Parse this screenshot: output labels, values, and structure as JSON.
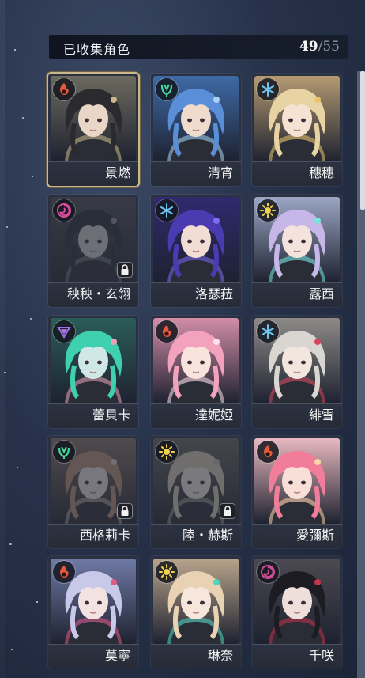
{
  "header": {
    "title": "已收集角色",
    "collected": "49",
    "separator": "/",
    "total": "55"
  },
  "characters": [
    {
      "name": "景燃",
      "element": "fire",
      "locked": false,
      "selected": true,
      "hair": "#2b2a2e",
      "skin": "#e9d6c6",
      "bg": "#6c6a5e",
      "accent": "#c9b98a"
    },
    {
      "name": "清宵",
      "element": "wind",
      "locked": false,
      "selected": false,
      "hair": "#5a8ed6",
      "skin": "#f0dccd",
      "bg": "#3e6aa6",
      "accent": "#a9d3f2"
    },
    {
      "name": "穗穗",
      "element": "ice",
      "locked": false,
      "selected": false,
      "hair": "#e8d3a4",
      "skin": "#f6e2d2",
      "bg": "#b49a72",
      "accent": "#e9c46a"
    },
    {
      "name": "秧秧・玄翎",
      "element": "void",
      "locked": true,
      "selected": false,
      "hair": "#2a2a33",
      "skin": "#cfc3bb",
      "bg": "#4a4a50",
      "accent": "#888888"
    },
    {
      "name": "洛瑟菈",
      "element": "ice",
      "locked": false,
      "selected": false,
      "hair": "#4b3bb0",
      "skin": "#f1ddd4",
      "bg": "#2f2a6e",
      "accent": "#7f6cf0"
    },
    {
      "name": "露西",
      "element": "light",
      "locked": false,
      "selected": false,
      "hair": "#c7b6e8",
      "skin": "#f4e3dc",
      "bg": "#9ba6c4",
      "accent": "#75e6e0"
    },
    {
      "name": "蕾貝卡",
      "element": "aero",
      "locked": false,
      "selected": false,
      "hair": "#3fd0b0",
      "skin": "#cfe7e6",
      "bg": "#2b5c58",
      "accent": "#f0a0b8"
    },
    {
      "name": "達妮婭",
      "element": "fire",
      "locked": false,
      "selected": false,
      "hair": "#f3a2bd",
      "skin": "#f8e4dc",
      "bg": "#d28ea8",
      "accent": "#ffe0ea"
    },
    {
      "name": "緋雪",
      "element": "ice",
      "locked": false,
      "selected": false,
      "hair": "#d9d6d2",
      "skin": "#f3e6de",
      "bg": "#8d8a88",
      "accent": "#d6455a"
    },
    {
      "name": "西格莉卡",
      "element": "wind",
      "locked": true,
      "selected": false,
      "hair": "#e7803a",
      "skin": "#f0d6c4",
      "bg": "#9a6a4a",
      "accent": "#f3c38a"
    },
    {
      "name": "陸・赫斯",
      "element": "light",
      "locked": true,
      "selected": false,
      "hair": "#d9c48a",
      "skin": "#eedcc6",
      "bg": "#6b6450",
      "accent": "#c8b27a"
    },
    {
      "name": "愛彌斯",
      "element": "fire",
      "locked": false,
      "selected": false,
      "hair": "#f27d9b",
      "skin": "#f8e0d8",
      "bg": "#e8b9c0",
      "accent": "#ffd4a8"
    },
    {
      "name": "莫寧",
      "element": "fire",
      "locked": false,
      "selected": false,
      "hair": "#c8c8e8",
      "skin": "#f2e2e0",
      "bg": "#6f7aa6",
      "accent": "#e05a86"
    },
    {
      "name": "琳奈",
      "element": "light",
      "locked": false,
      "selected": false,
      "hair": "#e9d2b4",
      "skin": "#f6e6dc",
      "bg": "#b8a48c",
      "accent": "#4bd6c0"
    },
    {
      "name": "千咲",
      "element": "void",
      "locked": false,
      "selected": false,
      "hair": "#1c1c22",
      "skin": "#eedfdb",
      "bg": "#4c4a52",
      "accent": "#c5344a"
    }
  ],
  "colors": {
    "fire": "#e8583a",
    "wind": "#47d69a",
    "ice": "#6cc6f0",
    "void": "#d64c9a",
    "light": "#f2d24a",
    "aero": "#a872e6"
  }
}
